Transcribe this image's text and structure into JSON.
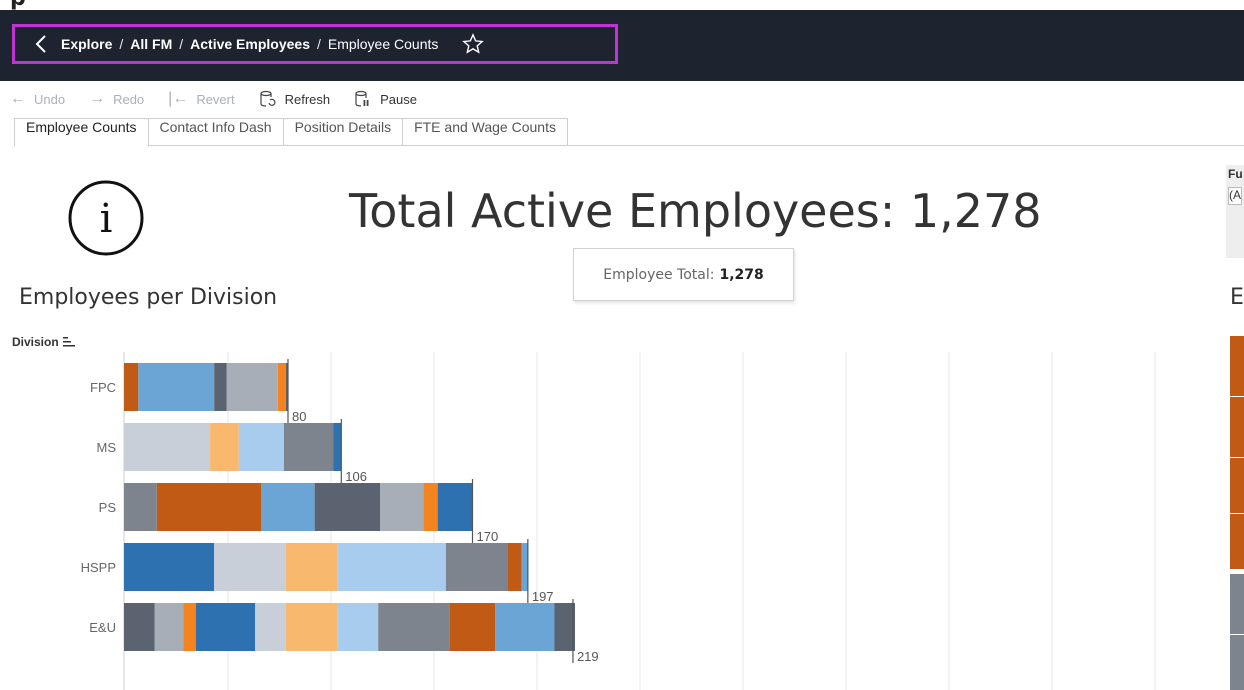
{
  "navbar": {
    "crumbs": [
      "Explore",
      "All FM",
      "Active Employees",
      "Employee Counts"
    ],
    "separator": "/",
    "accent_border": "#c233d6",
    "background": "#1e2330"
  },
  "toolbar": {
    "undo": "Undo",
    "redo": "Redo",
    "revert": "Revert",
    "refresh": "Refresh",
    "pause": "Pause"
  },
  "tabs": [
    "Employee Counts",
    "Contact Info Dash",
    "Position Details",
    "FTE and Wage Counts"
  ],
  "active_tab": "Employee Counts",
  "page": {
    "title": "Total Active Employees: 1,278",
    "tooltip_label": "Employee Total:",
    "tooltip_value": "1,278",
    "section_title": "Employees per Division",
    "division_header": "Division",
    "filter_peek_label": "Fu",
    "filter_peek_value": "(A",
    "right_section_peek": "E"
  },
  "colors": {
    "dark_orange": "#c05a15",
    "mid_blue": "#6aa5d6",
    "slate": "#5b6270",
    "light_gray": "#a7aeb8",
    "orange": "#f5831f",
    "pale_gray": "#c8cfd8",
    "peach": "#f8b86e",
    "light_blue": "#a8cced",
    "gray": "#7d848e",
    "blue": "#2e71b0"
  },
  "chart_data": {
    "type": "bar",
    "orientation": "horizontal",
    "stacked": true,
    "categories": [
      "FPC",
      "MS",
      "PS",
      "HSPP",
      "E&U"
    ],
    "totals": [
      80,
      106,
      170,
      197,
      219
    ],
    "total_labels": [
      "80",
      "106",
      "170",
      "197",
      "219"
    ],
    "segments": [
      [
        {
          "color": "dark_orange",
          "value": 7
        },
        {
          "color": "mid_blue",
          "value": 37
        },
        {
          "color": "slate",
          "value": 6
        },
        {
          "color": "light_gray",
          "value": 25
        },
        {
          "color": "orange",
          "value": 4
        },
        {
          "color": "slate",
          "value": 1
        }
      ],
      [
        {
          "color": "pale_gray",
          "value": 42
        },
        {
          "color": "peach",
          "value": 14
        },
        {
          "color": "light_blue",
          "value": 22
        },
        {
          "color": "gray",
          "value": 24
        },
        {
          "color": "blue",
          "value": 4
        }
      ],
      [
        {
          "color": "gray",
          "value": 16
        },
        {
          "color": "dark_orange",
          "value": 51
        },
        {
          "color": "mid_blue",
          "value": 26
        },
        {
          "color": "slate",
          "value": 32
        },
        {
          "color": "light_gray",
          "value": 21
        },
        {
          "color": "orange",
          "value": 7
        },
        {
          "color": "blue",
          "value": 17
        }
      ],
      [
        {
          "color": "blue",
          "value": 44
        },
        {
          "color": "pale_gray",
          "value": 35
        },
        {
          "color": "peach",
          "value": 25
        },
        {
          "color": "light_blue",
          "value": 53
        },
        {
          "color": "gray",
          "value": 30
        },
        {
          "color": "dark_orange",
          "value": 7
        },
        {
          "color": "mid_blue",
          "value": 3
        }
      ],
      [
        {
          "color": "slate",
          "value": 15
        },
        {
          "color": "light_gray",
          "value": 14
        },
        {
          "color": "orange",
          "value": 6
        },
        {
          "color": "blue",
          "value": 29
        },
        {
          "color": "pale_gray",
          "value": 15
        },
        {
          "color": "peach",
          "value": 25
        },
        {
          "color": "light_blue",
          "value": 20
        },
        {
          "color": "gray",
          "value": 35
        },
        {
          "color": "dark_orange",
          "value": 22
        },
        {
          "color": "mid_blue",
          "value": 29
        },
        {
          "color": "slate",
          "value": 10
        }
      ]
    ]
  }
}
